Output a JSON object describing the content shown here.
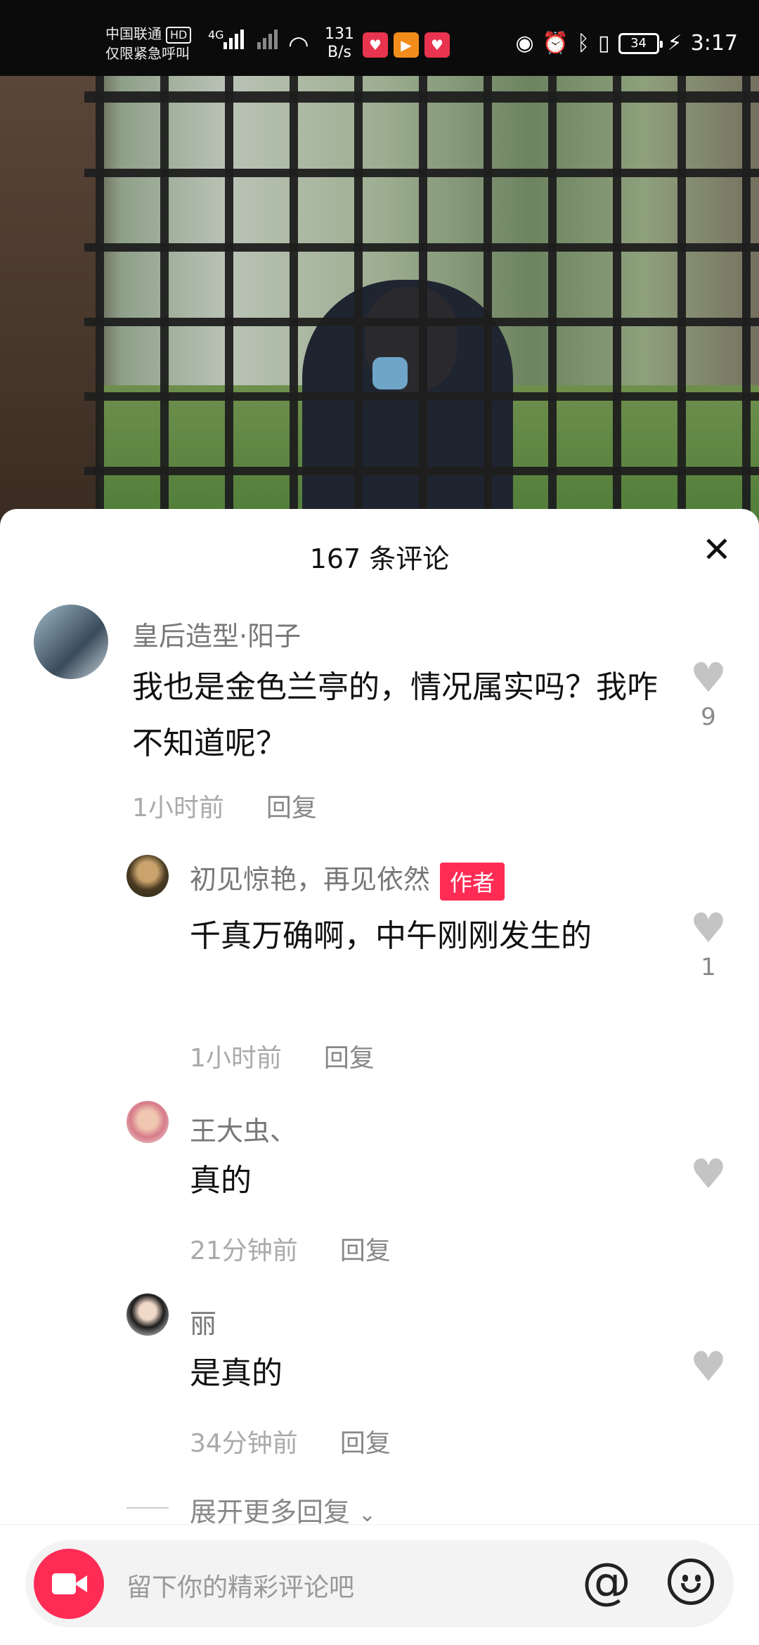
{
  "status_bar": {
    "carrier_line1": "中国联通",
    "carrier_hd": "HD",
    "carrier_line2": "仅限紧急呼叫",
    "network": "4G",
    "speed_value": "131",
    "speed_unit": "B/s",
    "battery": "34",
    "time": "3:17",
    "icons": [
      "signal-icon",
      "wifi-icon",
      "app-badge-icon",
      "eye-icon",
      "alarm-icon",
      "bluetooth-icon",
      "vibrate-icon",
      "battery-icon",
      "charging-icon"
    ]
  },
  "sheet": {
    "title": "167 条评论",
    "close_icon": "close-icon"
  },
  "comments": [
    {
      "user": "皇后造型·阳子",
      "text": "我也是金色兰亭的，情况属实吗？我咋不知道呢？",
      "time": "1小时前",
      "reply": "回复",
      "likes": "9"
    },
    {
      "user": "初见惊艳，再见依然",
      "badge": "作者",
      "text": "千真万确啊，中午刚刚发生的",
      "time": "1小时前",
      "reply": "回复",
      "likes": "1"
    },
    {
      "user": "王大虫、",
      "text": "真的",
      "time": "21分钟前",
      "reply": "回复"
    },
    {
      "user": "丽",
      "text": "是真的",
      "time": "34分钟前",
      "reply": "回复"
    }
  ],
  "expand_more": "展开更多回复",
  "input": {
    "placeholder": "留下你的精彩评论吧",
    "at_symbol": "@"
  },
  "colors": {
    "accent": "#fe2c55",
    "heart_inactive": "#c4c4c4"
  }
}
